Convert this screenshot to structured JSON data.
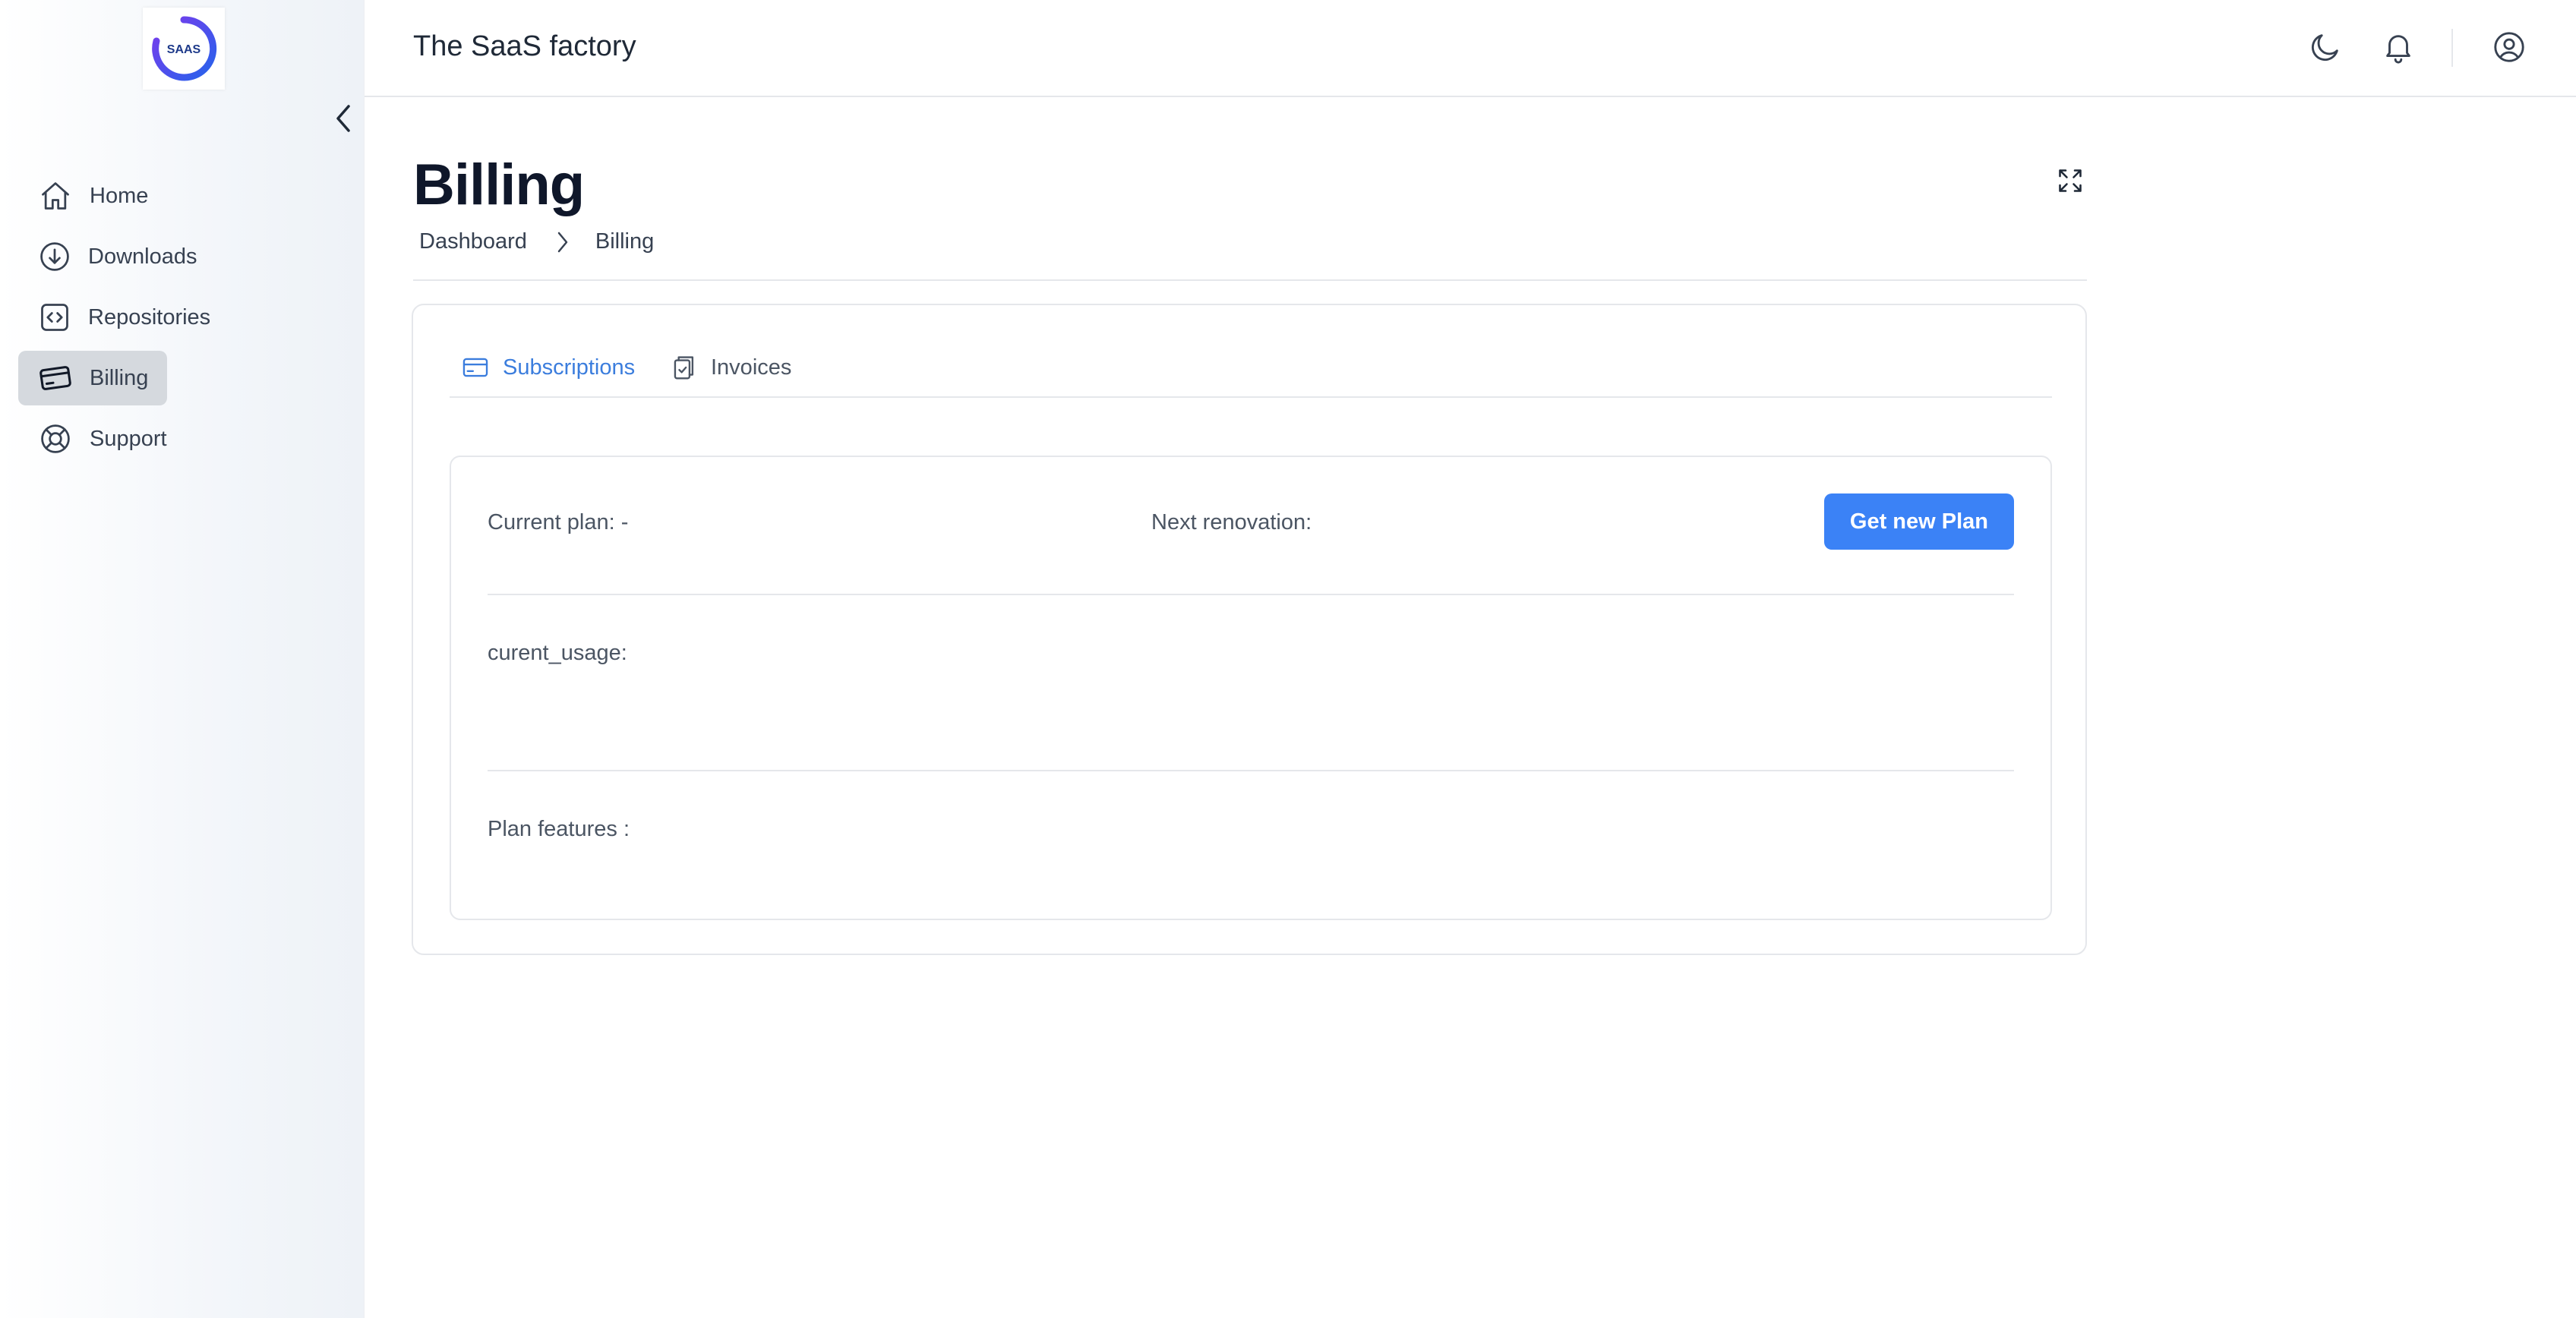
{
  "sidebar": {
    "logo_text": "SAAS",
    "items": [
      {
        "label": "Home",
        "icon": "home-icon"
      },
      {
        "label": "Downloads",
        "icon": "download-icon"
      },
      {
        "label": "Repositories",
        "icon": "code-icon"
      },
      {
        "label": "Billing",
        "icon": "credit-card-icon",
        "active": true
      },
      {
        "label": "Support",
        "icon": "lifebuoy-icon"
      }
    ]
  },
  "header": {
    "app_title": "The SaaS factory"
  },
  "page": {
    "title": "Billing",
    "breadcrumb": [
      "Dashboard",
      "Billing"
    ]
  },
  "tabs": [
    {
      "label": "Subscriptions",
      "icon": "credit-card-icon",
      "active": true
    },
    {
      "label": "Invoices",
      "icon": "clipboard-check-icon",
      "active": false
    }
  ],
  "subscription": {
    "current_plan_label": "Current plan: -",
    "next_renovation_label": "Next renovation:",
    "get_plan_button": "Get new Plan",
    "usage_label": "curent_usage:",
    "features_label": "Plan features :"
  },
  "colors": {
    "accent": "#3b82f6",
    "active_tab": "#3b7ddd",
    "active_nav_bg": "#d5d9de"
  }
}
